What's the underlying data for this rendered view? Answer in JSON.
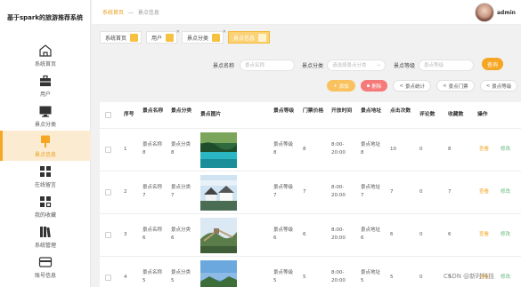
{
  "app": {
    "title": "基于spark的旅游推荐系统"
  },
  "sidebar": {
    "items": [
      {
        "label": "系统首页",
        "icon": "home-icon"
      },
      {
        "label": "用户",
        "icon": "briefcase-icon"
      },
      {
        "label": "景点分类",
        "icon": "monitor-icon"
      },
      {
        "label": "景点信息",
        "icon": "brush-icon"
      },
      {
        "label": "在线留言",
        "icon": "grid-icon"
      },
      {
        "label": "我的收藏",
        "icon": "apps-icon"
      },
      {
        "label": "系统管理",
        "icon": "book-icon"
      },
      {
        "label": "账号信息",
        "icon": "id-card-icon"
      }
    ]
  },
  "header": {
    "breadcrumb_home": "系统首页",
    "breadcrumb_sep": "—",
    "breadcrumb_current": "景点信息",
    "username": "admin"
  },
  "tabs": [
    {
      "label": "系统首页"
    },
    {
      "label": "用户"
    },
    {
      "label": "景点分类"
    },
    {
      "label": "景点信息"
    }
  ],
  "search": {
    "name_label": "景点名称",
    "name_placeholder": "景点名称",
    "category_label": "景点分类",
    "category_placeholder": "请选择景点分类",
    "level_label": "景点等级",
    "level_placeholder": "景点等级",
    "button": "查询"
  },
  "actions": {
    "add": "添加",
    "delete": "删除",
    "stat1": "景点统计",
    "stat2": "景点门票",
    "stat3": "景点等级"
  },
  "table": {
    "headers": [
      "序号",
      "景点名称",
      "景点分类",
      "景点图片",
      "景点等级",
      "门票价格",
      "开放时间",
      "景点地址",
      "点击次数",
      "评论数",
      "收藏数",
      "操作"
    ],
    "rows": [
      {
        "index": "1",
        "name": "景点名称8",
        "category": "景点分类8",
        "level": "景点等级8",
        "price": "8",
        "time": "8:00-20:00",
        "address": "景点地址8",
        "clicks": "10",
        "comments": "0",
        "favorites": "8",
        "edit": "查看",
        "view": "修改"
      },
      {
        "index": "2",
        "name": "景点名称7",
        "category": "景点分类7",
        "level": "景点等级7",
        "price": "7",
        "time": "8:00-20:00",
        "address": "景点地址7",
        "clicks": "7",
        "comments": "0",
        "favorites": "7",
        "edit": "查看",
        "view": "修改"
      },
      {
        "index": "3",
        "name": "景点名称6",
        "category": "景点分类6",
        "level": "景点等级6",
        "price": "6",
        "time": "8:00-20:00",
        "address": "景点地址6",
        "clicks": "6",
        "comments": "0",
        "favorites": "6",
        "edit": "查看",
        "view": "修改"
      },
      {
        "index": "4",
        "name": "景点名称5",
        "category": "景点分类5",
        "level": "景点等级5",
        "price": "5",
        "time": "8:00-20:00",
        "address": "景点地址5",
        "clicks": "5",
        "comments": "0",
        "favorites": "5",
        "edit": "查看",
        "view": "修改"
      }
    ]
  },
  "watermark": "CSDN @新时科技",
  "colors": {
    "accent": "#f5a623",
    "danger": "#f67a7a",
    "active_bg": "#fbecd1"
  }
}
